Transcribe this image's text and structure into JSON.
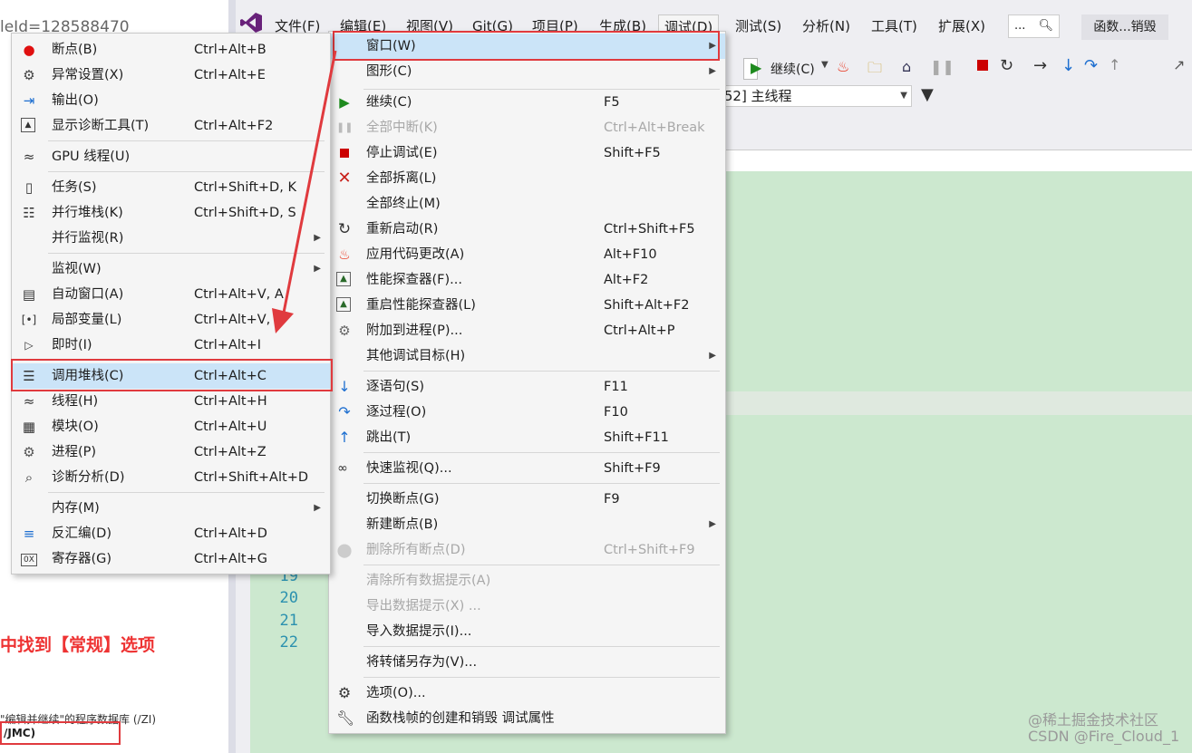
{
  "background": {
    "url_fragment": "leId=128588470",
    "heading": "中找到【常规】选项",
    "text_line": "\"编辑并继续\"的程序数据库 (/ZI)",
    "jmc_label": "/JMC)"
  },
  "vs": {
    "menubar": [
      {
        "label": "文件(F)"
      },
      {
        "label": "编辑(E)"
      },
      {
        "label": "视图(V)"
      },
      {
        "label": "Git(G)"
      },
      {
        "label": "项目(P)"
      },
      {
        "label": "生成(B)"
      },
      {
        "label": "调试(D)"
      },
      {
        "label": "测试(S)"
      },
      {
        "label": "分析(N)"
      },
      {
        "label": "工具(T)"
      },
      {
        "label": "扩展(X)"
      }
    ],
    "search_placeholder": "...",
    "function_button": "函数...销毁",
    "continue_label": "继续(C)",
    "thread_combo": "[52] 主线程",
    "line_numbers": [
      "19",
      "20",
      "21",
      "22"
    ],
    "watermark_line1": "@稀土掘金技术社区",
    "watermark_line2": "CSDN @Fire_Cloud_1",
    "accent_color": "#68217a",
    "highlight_border_color": "#e03a3e"
  },
  "debug_menu": {
    "items": [
      {
        "label": "窗口(W)",
        "shortcut": "",
        "icon": "none",
        "submenu": true,
        "highlighted": true
      },
      {
        "label": "图形(C)",
        "shortcut": "",
        "icon": "none",
        "submenu": true
      },
      {
        "label": "继续(C)",
        "shortcut": "F5",
        "icon": "play-icon"
      },
      {
        "label": "全部中断(K)",
        "shortcut": "Ctrl+Alt+Break",
        "icon": "pause-icon",
        "disabled": true
      },
      {
        "label": "停止调试(E)",
        "shortcut": "Shift+F5",
        "icon": "stop-icon"
      },
      {
        "label": "全部拆离(L)",
        "shortcut": "",
        "icon": "close-icon"
      },
      {
        "label": "全部终止(M)",
        "shortcut": "",
        "icon": "none"
      },
      {
        "label": "重新启动(R)",
        "shortcut": "Ctrl+Shift+F5",
        "icon": "restart-icon"
      },
      {
        "label": "应用代码更改(A)",
        "shortcut": "Alt+F10",
        "icon": "flame-icon"
      },
      {
        "label": "性能探查器(F)...",
        "shortcut": "Alt+F2",
        "icon": "profiler-icon"
      },
      {
        "label": "重启性能探查器(L)",
        "shortcut": "Shift+Alt+F2",
        "icon": "profiler-icon"
      },
      {
        "label": "附加到进程(P)...",
        "shortcut": "Ctrl+Alt+P",
        "icon": "gear-icon"
      },
      {
        "label": "其他调试目标(H)",
        "shortcut": "",
        "icon": "none",
        "submenu": true
      },
      {
        "label": "逐语句(S)",
        "shortcut": "F11",
        "icon": "step-into-icon"
      },
      {
        "label": "逐过程(O)",
        "shortcut": "F10",
        "icon": "step-over-icon"
      },
      {
        "label": "跳出(T)",
        "shortcut": "Shift+F11",
        "icon": "step-out-icon"
      },
      {
        "label": "快速监视(Q)...",
        "shortcut": "Shift+F9",
        "icon": "glasses-icon"
      },
      {
        "label": "切换断点(G)",
        "shortcut": "F9",
        "icon": "none"
      },
      {
        "label": "新建断点(B)",
        "shortcut": "",
        "icon": "none",
        "submenu": true
      },
      {
        "label": "删除所有断点(D)",
        "shortcut": "Ctrl+Shift+F9",
        "icon": "breakpoints-icon",
        "disabled": true
      },
      {
        "label": "清除所有数据提示(A)",
        "shortcut": "",
        "icon": "none",
        "disabled": true
      },
      {
        "label": "导出数据提示(X) ...",
        "shortcut": "",
        "icon": "none",
        "disabled": true
      },
      {
        "label": "导入数据提示(I)...",
        "shortcut": "",
        "icon": "none"
      },
      {
        "label": "将转储另存为(V)...",
        "shortcut": "",
        "icon": "none"
      },
      {
        "label": "选项(O)...",
        "shortcut": "",
        "icon": "gear-icon"
      },
      {
        "label": "函数栈帧的创建和销毁 调试属性",
        "shortcut": "",
        "icon": "wrench-icon"
      }
    ]
  },
  "window_submenu": {
    "items": [
      {
        "label": "断点(B)",
        "shortcut": "Ctrl+Alt+B",
        "icon": "breakpoint-icon"
      },
      {
        "label": "异常设置(X)",
        "shortcut": "Ctrl+Alt+E",
        "icon": "exception-icon"
      },
      {
        "label": "输出(O)",
        "shortcut": "",
        "icon": "output-icon"
      },
      {
        "label": "显示诊断工具(T)",
        "shortcut": "Ctrl+Alt+F2",
        "icon": "diagnostics-icon"
      },
      {
        "label": "GPU 线程(U)",
        "shortcut": "",
        "icon": "threads-icon"
      },
      {
        "label": "任务(S)",
        "shortcut": "Ctrl+Shift+D, K",
        "icon": "clipboard-icon"
      },
      {
        "label": "并行堆栈(K)",
        "shortcut": "Ctrl+Shift+D, S",
        "icon": "parallel-stacks-icon"
      },
      {
        "label": "并行监视(R)",
        "shortcut": "",
        "icon": "none",
        "submenu": true
      },
      {
        "label": "监视(W)",
        "shortcut": "",
        "icon": "none",
        "submenu": true
      },
      {
        "label": "自动窗口(A)",
        "shortcut": "Ctrl+Alt+V, A",
        "icon": "autos-icon"
      },
      {
        "label": "局部变量(L)",
        "shortcut": "Ctrl+Alt+V,",
        "icon": "locals-icon"
      },
      {
        "label": "即时(I)",
        "shortcut": "Ctrl+Alt+I",
        "icon": "immediate-icon"
      },
      {
        "label": "调用堆栈(C)",
        "shortcut": "Ctrl+Alt+C",
        "icon": "call-stack-icon",
        "highlighted": true
      },
      {
        "label": "线程(H)",
        "shortcut": "Ctrl+Alt+H",
        "icon": "threads-icon"
      },
      {
        "label": "模块(O)",
        "shortcut": "Ctrl+Alt+U",
        "icon": "modules-icon"
      },
      {
        "label": "进程(P)",
        "shortcut": "Ctrl+Alt+Z",
        "icon": "process-icon"
      },
      {
        "label": "诊断分析(D)",
        "shortcut": "Ctrl+Shift+Alt+D",
        "icon": "analysis-icon"
      },
      {
        "label": "内存(M)",
        "shortcut": "",
        "icon": "none",
        "submenu": true
      },
      {
        "label": "反汇编(D)",
        "shortcut": "Ctrl+Alt+D",
        "icon": "disassembly-icon"
      },
      {
        "label": "寄存器(G)",
        "shortcut": "Ctrl+Alt+G",
        "icon": "registers-icon"
      }
    ]
  }
}
